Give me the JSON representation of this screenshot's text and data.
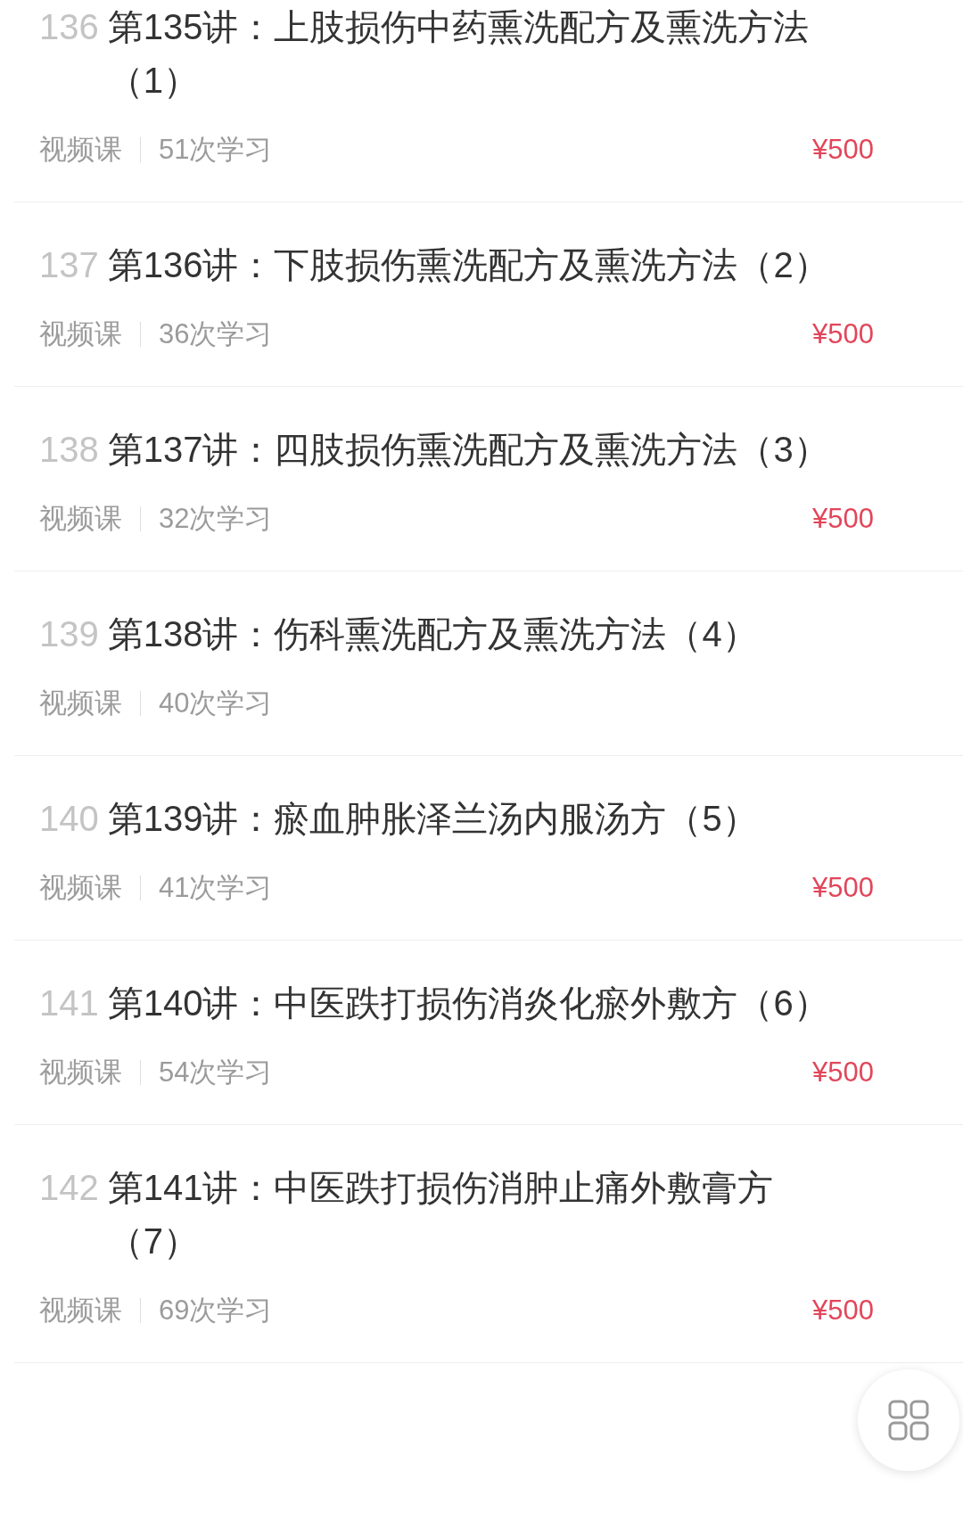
{
  "lessons": [
    {
      "number": "136",
      "title": "第135讲：上肢损伤中药熏洗配方及熏洗方法（1）",
      "type": "视频课",
      "learners": "51次学习",
      "price": "¥500"
    },
    {
      "number": "137",
      "title": "第136讲：下肢损伤熏洗配方及熏洗方法（2）",
      "type": "视频课",
      "learners": "36次学习",
      "price": "¥500"
    },
    {
      "number": "138",
      "title": "第137讲：四肢损伤熏洗配方及熏洗方法（3）",
      "type": "视频课",
      "learners": "32次学习",
      "price": "¥500"
    },
    {
      "number": "139",
      "title": "第138讲：伤科熏洗配方及熏洗方法（4）",
      "type": "视频课",
      "learners": "40次学习"
    },
    {
      "number": "140",
      "title": "第139讲：瘀血肿胀泽兰汤内服汤方（5）",
      "type": "视频课",
      "learners": "41次学习",
      "price": "¥500"
    },
    {
      "number": "141",
      "title": "第140讲：中医跌打损伤消炎化瘀外敷方（6）",
      "type": "视频课",
      "learners": "54次学习",
      "price": "¥500"
    },
    {
      "number": "142",
      "title": "第141讲：中医跌打损伤消肿止痛外敷膏方（7）",
      "type": "视频课",
      "learners": "69次学习",
      "price": "¥500"
    }
  ]
}
